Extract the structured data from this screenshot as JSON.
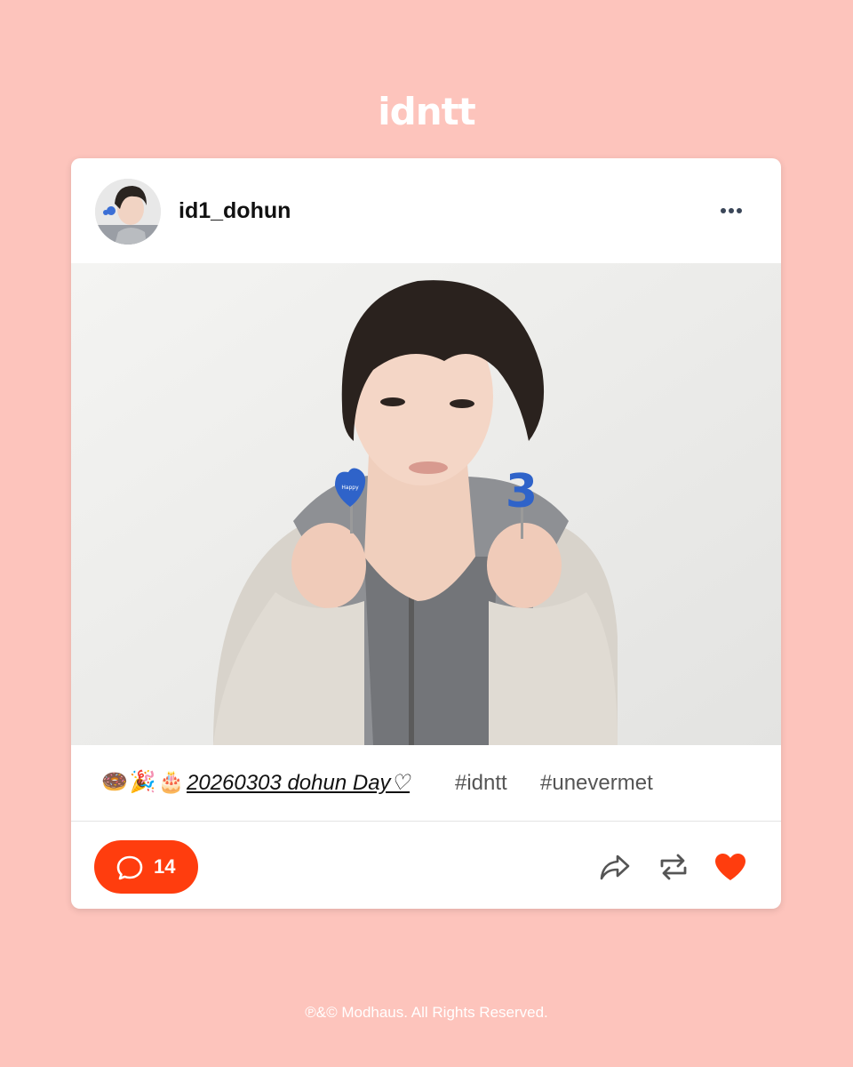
{
  "brand": {
    "logo_text": "idntt"
  },
  "post": {
    "username": "id1_dohun",
    "avatar_icon": "avatar-photo",
    "more_icon": "more-horizontal-icon",
    "photo_description_icon": "post-photo",
    "caption": {
      "emojis": [
        "🍩",
        "🎉",
        "🎂"
      ],
      "link_text": "20260303 dohun Day♡",
      "hashtags": [
        "#idntt",
        "#unevermet"
      ]
    },
    "actions": {
      "comment_count": "14",
      "comment_icon": "comment-bubble-icon",
      "share_icon": "share-icon",
      "repost_icon": "repost-icon",
      "like_icon": "heart-icon"
    }
  },
  "footer": {
    "copyright": "℗&© Modhaus. All Rights Reserved."
  },
  "colors": {
    "background": "#fdc4bc",
    "accent": "#ff3d0e",
    "card": "#ffffff"
  }
}
